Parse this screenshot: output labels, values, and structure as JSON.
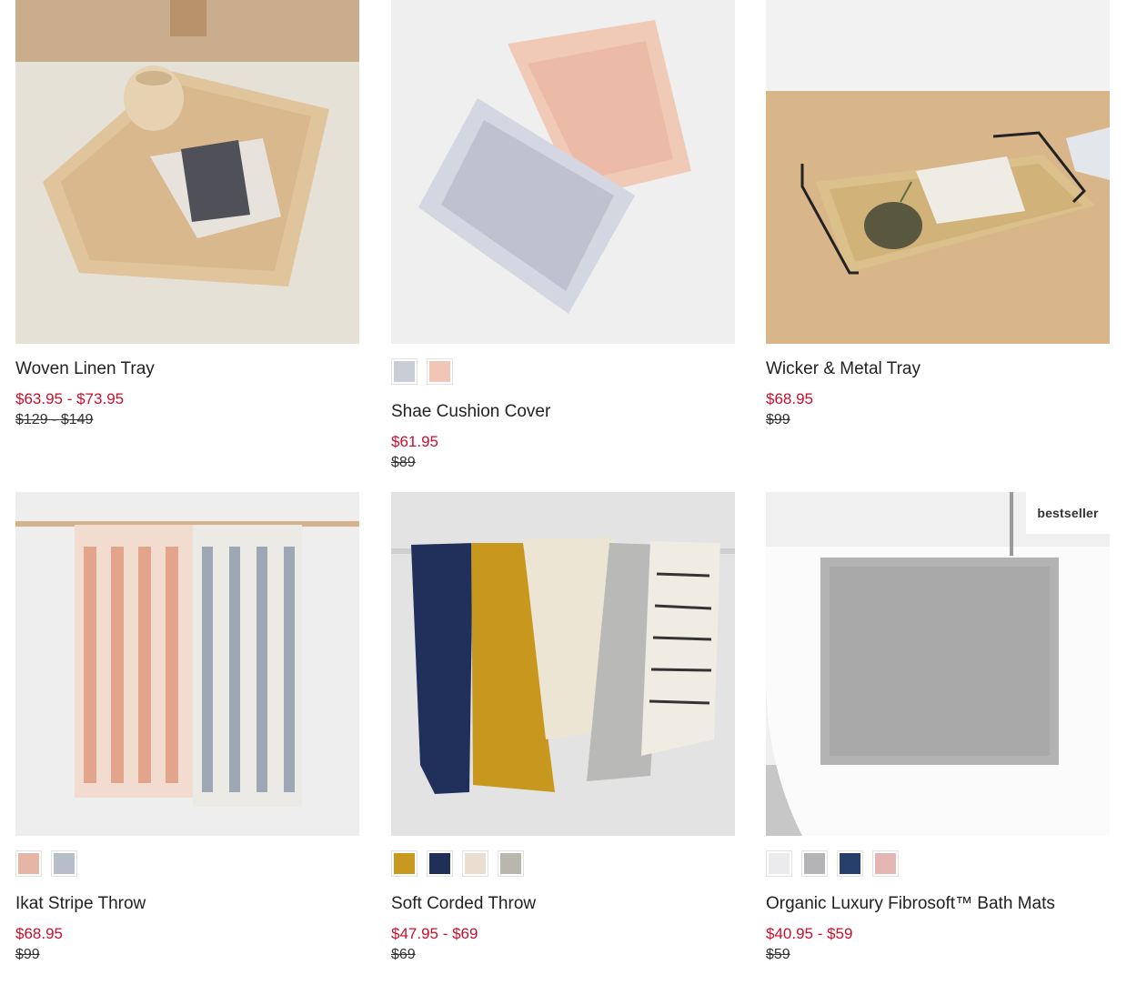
{
  "products": [
    {
      "name": "Woven Linen Tray",
      "sale_price": "$63.95 - $73.95",
      "original_price": "$129 - $149",
      "swatches": []
    },
    {
      "name": "Shae Cushion Cover",
      "sale_price": "$61.95",
      "original_price": "$89",
      "swatches": [
        "#c9cdd8",
        "#f1c6b6"
      ]
    },
    {
      "name": "Wicker & Metal Tray",
      "sale_price": "$68.95",
      "original_price": "$99",
      "swatches": []
    },
    {
      "name": "Ikat Stripe Throw",
      "sale_price": "$68.95",
      "original_price": "$99",
      "swatches": [
        "#e7b5a3",
        "#b8bec9"
      ]
    },
    {
      "name": "Soft Corded Throw",
      "sale_price": "$47.95 - $69",
      "original_price": "$69",
      "swatches": [
        "#c9981f",
        "#1f2f55",
        "#e9ded0",
        "#b9b6ad"
      ]
    },
    {
      "name": "Organic Luxury Fibrosoft™ Bath Mats",
      "sale_price": "$40.95 - $59",
      "original_price": "$59",
      "swatches": [
        "#ebebed",
        "#b4b4b6",
        "#253f6a",
        "#e3b6b3"
      ],
      "badge": "bestseller"
    }
  ],
  "colors": {
    "sale": "#c8102e",
    "text": "#222222"
  }
}
